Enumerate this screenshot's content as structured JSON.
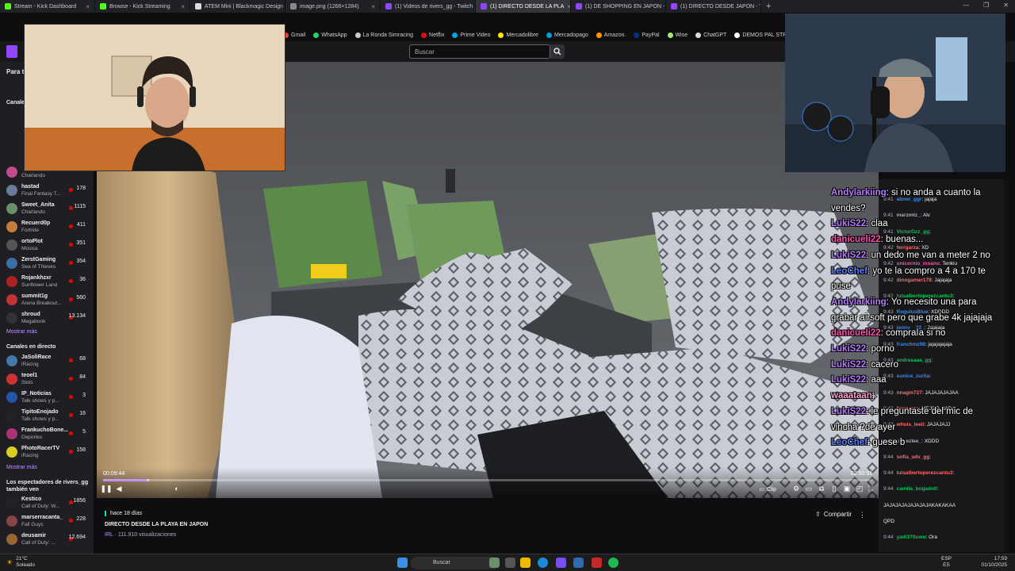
{
  "browser": {
    "tabs": [
      {
        "label": "Stream - Kick Dashboard",
        "color": "#53fc18",
        "active": false
      },
      {
        "label": "Browse - Kick Streaming",
        "color": "#53fc18",
        "active": false
      },
      {
        "label": "ATEM Mini | Blackmagic Design",
        "color": "#dddddd",
        "active": false
      },
      {
        "label": "image.png (1266×1284)",
        "color": "#888888",
        "active": false
      },
      {
        "label": "(1) Videos de rivers_gg - Twitch",
        "color": "#9146ff",
        "active": false
      },
      {
        "label": "(1) DIRECTO DESDE LA PLA",
        "color": "#9146ff",
        "active": true
      },
      {
        "label": "(1) DE SHOPPING EN JAPON - Tw",
        "color": "#9146ff",
        "active": false
      },
      {
        "label": "(1) DIRECTO DESDE JAPON - Twi",
        "color": "#9146ff",
        "active": false
      }
    ],
    "bookmarks": [
      {
        "label": "Gmail",
        "color": "#ea4335"
      },
      {
        "label": "WhatsApp",
        "color": "#25d366"
      },
      {
        "label": "La Ronda Simracing",
        "color": "#cccccc"
      },
      {
        "label": "Netflix",
        "color": "#e50914"
      },
      {
        "label": "Prime Video",
        "color": "#00a8e1"
      },
      {
        "label": "Mercadolibre",
        "color": "#ffe600"
      },
      {
        "label": "Mercadopago",
        "color": "#009ee3"
      },
      {
        "label": "Amazon.",
        "color": "#ff9900"
      },
      {
        "label": "PayPal",
        "color": "#003087"
      },
      {
        "label": "Wise",
        "color": "#9fe870"
      },
      {
        "label": "ChatGPT",
        "color": "#dddddd"
      },
      {
        "label": "DEMOS PAL STREAM",
        "color": "#ffffff"
      },
      {
        "label": "JUAN TUR",
        "color": "#ffffff"
      }
    ]
  },
  "nav": {
    "search_placeholder": "Buscar",
    "sidebar_partial_label": "Para t"
  },
  "sidebar": {
    "followed_heading": "Canales",
    "followed": [
      {
        "name": "",
        "game": "Charlando",
        "viewers": "",
        "color": "#c04a8a"
      },
      {
        "name": "hastad",
        "game": "Final Fantasy T...",
        "viewers": "178",
        "color": "#6b7c9a"
      },
      {
        "name": "Sweet_Anita",
        "game": "Charlando",
        "viewers": "1115",
        "color": "#6a8f6a"
      },
      {
        "name": "Recuerd0p",
        "game": "Fortnite",
        "viewers": "411",
        "color": "#c87c3c"
      },
      {
        "name": "ortoPlot",
        "game": "Música",
        "viewers": "351",
        "color": "#555555"
      },
      {
        "name": "ZerstGaming",
        "game": "Sea of Thieves",
        "viewers": "354",
        "color": "#3a6ea5"
      },
      {
        "name": "Rojankhzxr",
        "game": "Sunflower Land",
        "viewers": "36",
        "color": "#aa2222"
      },
      {
        "name": "summit1g",
        "game": "Arena Breakout...",
        "viewers": "560",
        "color": "#c33333"
      },
      {
        "name": "shroud",
        "game": "Megabonk",
        "viewers": "13.134",
        "color": "#333333"
      }
    ],
    "more_label": "Mostrar más",
    "live_heading": "Canales en directo",
    "live": [
      {
        "name": "JaSoliRace",
        "game": "iRacing",
        "viewers": "68",
        "color": "#4477aa"
      },
      {
        "name": "teoel1",
        "game": "Slots",
        "viewers": "84",
        "color": "#cc3333"
      },
      {
        "name": "IP_Noticias",
        "game": "Talk shows y p...",
        "viewers": "3",
        "color": "#2255aa"
      },
      {
        "name": "TipitoEnojado",
        "game": "Talk shows y p...",
        "viewers": "16",
        "color": "#222222"
      },
      {
        "name": "FrankuchoBone...",
        "game": "Deportes",
        "viewers": "5",
        "color": "#aa3377"
      },
      {
        "name": "PhotoRacerTV",
        "game": "iRacing",
        "viewers": "158",
        "color": "#ddcc22"
      }
    ],
    "more_label_2": "Mostrar más",
    "also_heading": "Los espectadores de rivers_gg también ven",
    "also": [
      {
        "name": "Kestico",
        "game": "Call of Duty: W...",
        "viewers": "1856",
        "color": "#222222"
      },
      {
        "name": "marserracanta_",
        "game": "Fall Guys",
        "viewers": "228",
        "color": "#884444"
      },
      {
        "name": "deusamir",
        "game": "Call of Duty: ...",
        "viewers": "12.694",
        "color": "#996633"
      }
    ]
  },
  "player": {
    "time_current": "00:09:44",
    "time_total": "02:50:33",
    "progress": 0.057,
    "buffered": 0.06,
    "clip_label": "Clip"
  },
  "video_info": {
    "ago": "hace 18 días",
    "title": "DIRECTO DESDE LA PLAYA EN JAPON",
    "category": "IRL",
    "views": "111.910 visualizaciones",
    "share_label": "Compartir"
  },
  "overlay_chat": [
    {
      "user": "Andylarkiing",
      "color": "#b77bff",
      "text": ": si no anda a cuanto la"
    },
    {
      "user": "",
      "color": "#ffffff",
      "text": "vendes?"
    },
    {
      "user": "LukiS22",
      "color": "#b77bff",
      "text": ": claa"
    },
    {
      "user": "danicueli22",
      "color": "#ff4fb0",
      "text": ": buenas..."
    },
    {
      "user": "LukiS22",
      "color": "#b77bff",
      "text": ": un dedo me van a meter 2 no"
    },
    {
      "user": "LeoChef",
      "color": "#5b7bff",
      "text": ": yo te la compro a 4 a 170 te"
    },
    {
      "user": "",
      "color": "#ffffff",
      "text": "puse"
    },
    {
      "user": "Andylarkiing",
      "color": "#b77bff",
      "text": ": Yo necesito una para"
    },
    {
      "user": "",
      "color": "#ffffff",
      "text": "grabar airsoft pero que grabe 4k jajajaja"
    },
    {
      "user": "danicueli22",
      "color": "#ff4fb0",
      "text": ": compraIa si no"
    },
    {
      "user": "LukiS22",
      "color": "#b77bff",
      "text": ": porno"
    },
    {
      "user": "LukiS22",
      "color": "#b77bff",
      "text": ": cacero"
    },
    {
      "user": "LukiS22",
      "color": "#b77bff",
      "text": ": aaa"
    },
    {
      "user": "waaataan",
      "color": "#ff9bd0",
      "text": ":"
    },
    {
      "user": "LukiS22",
      "color": "#b77bff",
      "text": ": le preguntaste del mic de"
    },
    {
      "user": "",
      "color": "#ffffff",
      "text": "vincha ?de ayer"
    },
    {
      "user": "LeoChef",
      "color": "#5b7bff",
      "text": ": guese b"
    }
  ],
  "chat": [
    {
      "time": "9:41",
      "user": "abner_ggr",
      "color": "#2e8bff",
      "text": ": jajaja"
    },
    {
      "time": "9:41",
      "user": "marzmtz_",
      "color": "#adadb8",
      "text": ": Alv"
    },
    {
      "time": "9:41",
      "user": "VictorGzz_gg",
      "color": "#00c853",
      "text": ":"
    },
    {
      "time": "9:42",
      "user": "ferrgarza",
      "color": "#ff6b6b",
      "text": ": XD"
    },
    {
      "time": "9:42",
      "user": "unicornio_insano",
      "color": "#ff4fb0",
      "text": ": Tenkiu"
    },
    {
      "time": "9:42",
      "user": "dinogamer178",
      "color": "#ff6b6b",
      "text": ": Jajajaja"
    },
    {
      "time": "9:42",
      "user": "luisalbertoperezcantu3",
      "color": "#00c853",
      "text": ":"
    },
    {
      "time": "9:43",
      "user": "RegulusBlue",
      "color": "#2e8bff",
      "text": ": XDDDD"
    },
    {
      "time": "9:43",
      "user": "jenny__22_",
      "color": "#2e8bff",
      "text": ": Jajajaja"
    },
    {
      "time": "9:43",
      "user": "franchmz98",
      "color": "#2e8bff",
      "text": ": jajajajajaja"
    },
    {
      "time": "9:43",
      "user": "andreaaaa_gg",
      "color": "#00c853",
      "text": ":"
    },
    {
      "time": "9:43",
      "user": "eunice_zurita",
      "color": "#2e8bff",
      "text": ":"
    },
    {
      "time": "9:43",
      "user": "nnagm727",
      "color": "#ff6b6b",
      "text": ": JAJAJAJAJAA"
    },
    {
      "time": "9:43",
      "user": "ferrgarza",
      "color": "#ff6b6b",
      "text": ": MEJOR NADA"
    },
    {
      "time": "9:43",
      "user": "whois_leeli",
      "color": "#ff6b6b",
      "text": ": JAJAJAJJ"
    },
    {
      "time": "9:43",
      "user": "catrezlee_",
      "color": "#adadb8",
      "text": ": XDDD"
    },
    {
      "time": "9:44",
      "user": "sofia_sdv_gg",
      "color": "#ff6b6b",
      "text": ":"
    },
    {
      "time": "9:44",
      "user": "luisalbertoperezcantu3",
      "color": "#ff6b6b",
      "text": ":"
    },
    {
      "time": "9:44",
      "user": "camila_bogado0",
      "color": "#00c853",
      "text": ":"
    },
    {
      "time": "",
      "user": "",
      "color": "#efeff1",
      "text": "JAJAJAJAJAJAJAJAKAKAKAA"
    },
    {
      "time": "",
      "user": "",
      "color": "#efeff1",
      "text": "QPD"
    },
    {
      "time": "9:44",
      "user": "yadi370uwu",
      "color": "#00c853",
      "text": ": Ora"
    }
  ],
  "taskbar": {
    "weather_temp": "21°C",
    "weather_desc": "Soleado",
    "search_label": "Buscar",
    "lang_1": "ESP",
    "lang_2": "ES",
    "clock_time": "17:59",
    "clock_date": "01/10/2025"
  }
}
